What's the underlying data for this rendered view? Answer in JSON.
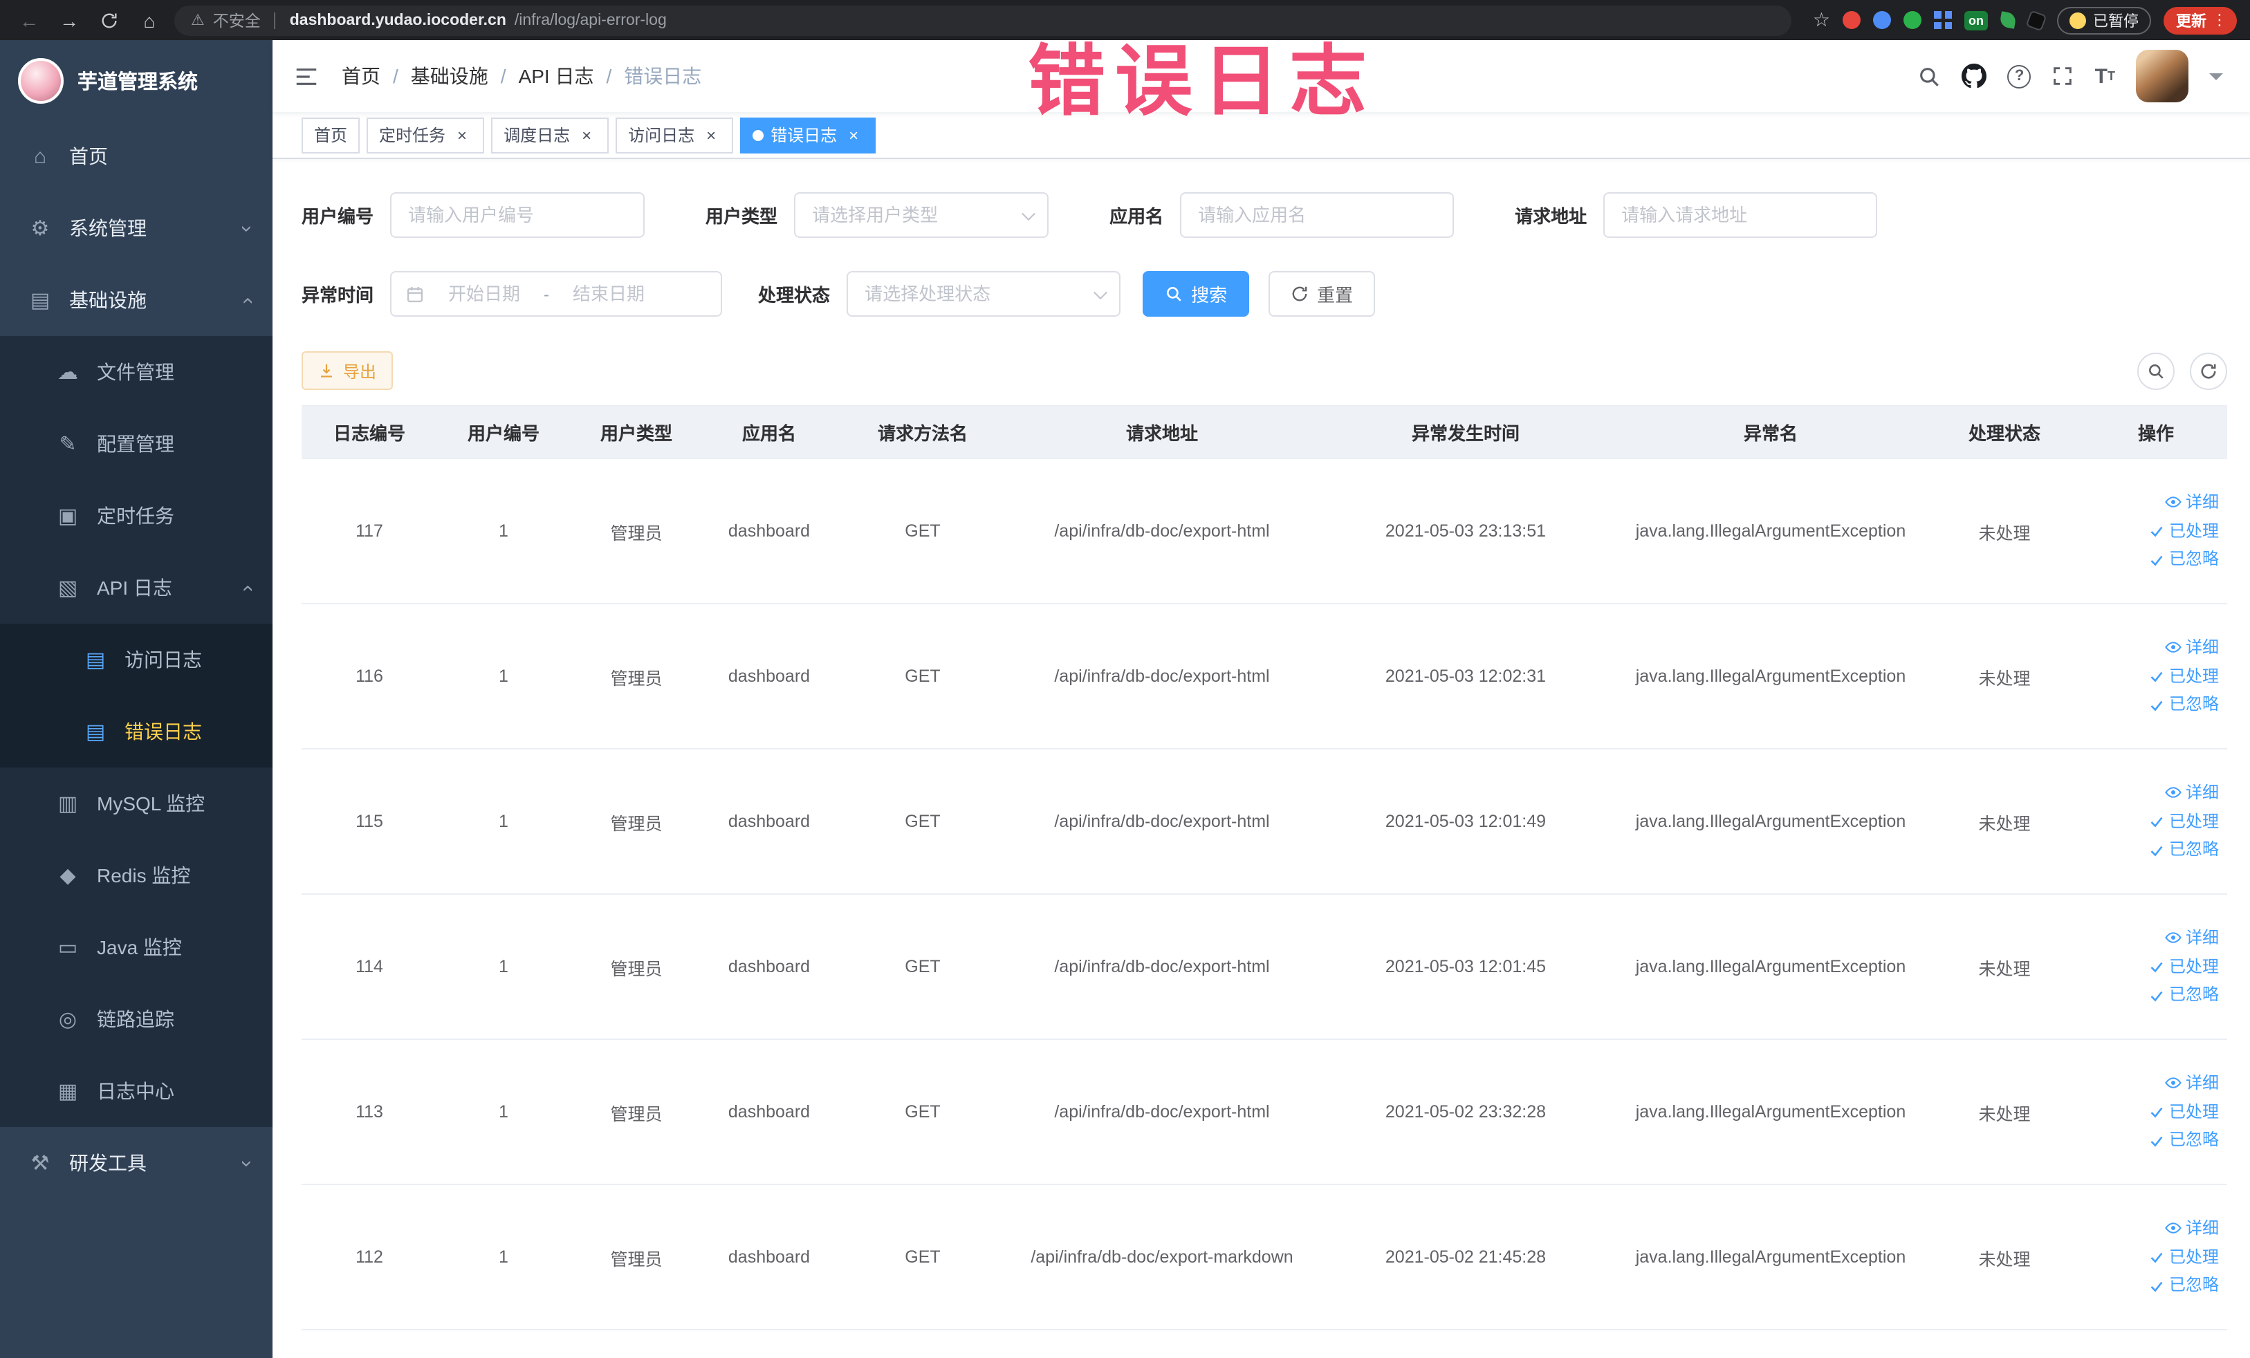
{
  "browser": {
    "security_label": "不安全",
    "url_host": "dashboard.yudao.iocoder.cn",
    "url_path": "/infra/log/api-error-log",
    "extension_badge": "on",
    "paused_button": "已暂停",
    "update_button": "更新"
  },
  "watermark": "错误日志",
  "sidebar": {
    "logo_title": "芋道管理系统",
    "menu": [
      {
        "key": "home",
        "label": "首页",
        "icon": "home-icon",
        "level": 0
      },
      {
        "key": "system",
        "label": "系统管理",
        "icon": "gear-icon",
        "level": 0,
        "chevron": "down"
      },
      {
        "key": "infra",
        "label": "基础设施",
        "icon": "monitor-icon",
        "level": 0,
        "chevron": "up"
      },
      {
        "key": "file",
        "label": "文件管理",
        "icon": "cloud-icon",
        "level": 1
      },
      {
        "key": "config",
        "label": "配置管理",
        "icon": "edit-icon",
        "level": 1
      },
      {
        "key": "job",
        "label": "定时任务",
        "icon": "task-icon",
        "level": 1
      },
      {
        "key": "api-log",
        "label": "API 日志",
        "icon": "log-icon",
        "level": 1,
        "chevron": "up"
      },
      {
        "key": "access-log",
        "label": "访问日志",
        "icon": "doc-icon",
        "level": 2,
        "icon_color": "blue"
      },
      {
        "key": "error-log",
        "label": "错误日志",
        "icon": "doc-icon",
        "level": 2,
        "icon_color": "blue",
        "active": true
      },
      {
        "key": "mysql",
        "label": "MySQL 监控",
        "icon": "database-icon",
        "level": 1
      },
      {
        "key": "redis",
        "label": "Redis 监控",
        "icon": "redis-icon",
        "level": 1
      },
      {
        "key": "java",
        "label": "Java 监控",
        "icon": "java-icon",
        "level": 1
      },
      {
        "key": "trace",
        "label": "链路追踪",
        "icon": "trace-icon",
        "level": 1
      },
      {
        "key": "log-center",
        "label": "日志中心",
        "icon": "log-center-icon",
        "level": 1
      },
      {
        "key": "dev-tools",
        "label": "研发工具",
        "icon": "tools-icon",
        "level": 0,
        "chevron": "down"
      }
    ]
  },
  "navbar": {
    "breadcrumb": [
      "首页",
      "基础设施",
      "API 日志",
      "错误日志"
    ],
    "separator": "/"
  },
  "tabs": [
    {
      "key": "home",
      "label": "首页",
      "closable": false,
      "active": false
    },
    {
      "key": "job",
      "label": "定时任务",
      "closable": true,
      "active": false
    },
    {
      "key": "schedule-log",
      "label": "调度日志",
      "closable": true,
      "active": false
    },
    {
      "key": "access-log",
      "label": "访问日志",
      "closable": true,
      "active": false
    },
    {
      "key": "error-log",
      "label": "错误日志",
      "closable": true,
      "active": true
    }
  ],
  "filters": {
    "user_id": {
      "label": "用户编号",
      "placeholder": "请输入用户编号"
    },
    "user_type": {
      "label": "用户类型",
      "placeholder": "请选择用户类型"
    },
    "app_name": {
      "label": "应用名",
      "placeholder": "请输入应用名"
    },
    "request_url": {
      "label": "请求地址",
      "placeholder": "请输入请求地址"
    },
    "exception_time": {
      "label": "异常时间",
      "start_placeholder": "开始日期",
      "end_placeholder": "结束日期",
      "range_separator": "-"
    },
    "process_status": {
      "label": "处理状态",
      "placeholder": "请选择处理状态"
    },
    "search_button": "搜索",
    "reset_button": "重置"
  },
  "toolbar": {
    "export_button": "导出"
  },
  "table": {
    "headers": [
      "日志编号",
      "用户编号",
      "用户类型",
      "应用名",
      "请求方法名",
      "请求地址",
      "异常发生时间",
      "异常名",
      "处理状态",
      "操作"
    ],
    "row_actions": [
      "详细",
      "已处理",
      "已忽略"
    ],
    "rows": [
      {
        "log_id": "117",
        "user_id": "1",
        "user_type": "管理员",
        "app_name": "dashboard",
        "method": "GET",
        "url": "/api/infra/db-doc/export-html",
        "time": "2021-05-03 23:13:51",
        "exception": "java.lang.IllegalArgumentException",
        "status": "未处理"
      },
      {
        "log_id": "116",
        "user_id": "1",
        "user_type": "管理员",
        "app_name": "dashboard",
        "method": "GET",
        "url": "/api/infra/db-doc/export-html",
        "time": "2021-05-03 12:02:31",
        "exception": "java.lang.IllegalArgumentException",
        "status": "未处理"
      },
      {
        "log_id": "115",
        "user_id": "1",
        "user_type": "管理员",
        "app_name": "dashboard",
        "method": "GET",
        "url": "/api/infra/db-doc/export-html",
        "time": "2021-05-03 12:01:49",
        "exception": "java.lang.IllegalArgumentException",
        "status": "未处理"
      },
      {
        "log_id": "114",
        "user_id": "1",
        "user_type": "管理员",
        "app_name": "dashboard",
        "method": "GET",
        "url": "/api/infra/db-doc/export-html",
        "time": "2021-05-03 12:01:45",
        "exception": "java.lang.IllegalArgumentException",
        "status": "未处理"
      },
      {
        "log_id": "113",
        "user_id": "1",
        "user_type": "管理员",
        "app_name": "dashboard",
        "method": "GET",
        "url": "/api/infra/db-doc/export-html",
        "time": "2021-05-02 23:32:28",
        "exception": "java.lang.IllegalArgumentException",
        "status": "未处理"
      },
      {
        "log_id": "112",
        "user_id": "1",
        "user_type": "管理员",
        "app_name": "dashboard",
        "method": "GET",
        "url": "/api/infra/db-doc/export-markdown",
        "time": "2021-05-02 21:45:28",
        "exception": "java.lang.IllegalArgumentException",
        "status": "未处理"
      }
    ]
  }
}
